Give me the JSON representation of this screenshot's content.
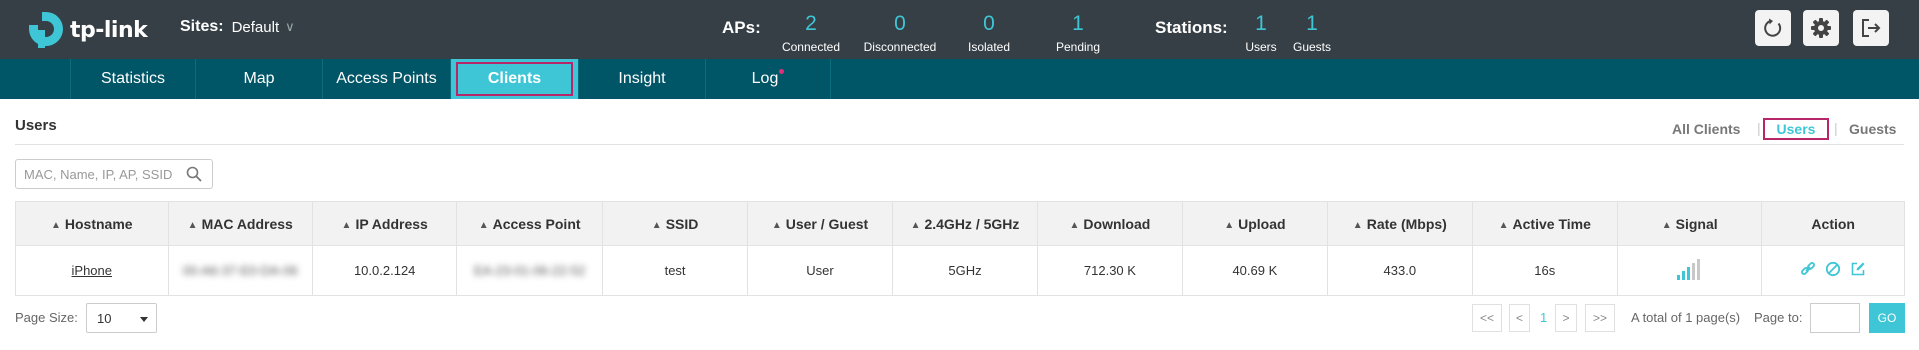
{
  "brand": {
    "name": "tp-link"
  },
  "header": {
    "sites_label": "Sites:",
    "site_value": "Default",
    "aps_label": "APs:",
    "aps": [
      {
        "value": "2",
        "caption": "Connected"
      },
      {
        "value": "0",
        "caption": "Disconnected"
      },
      {
        "value": "0",
        "caption": "Isolated"
      },
      {
        "value": "1",
        "caption": "Pending"
      }
    ],
    "stations_label": "Stations:",
    "stations": [
      {
        "value": "1",
        "caption": "Users"
      },
      {
        "value": "1",
        "caption": "Guests"
      }
    ],
    "icons": [
      "refresh-icon",
      "gear-icon",
      "logout-icon"
    ]
  },
  "nav": {
    "items": [
      "Statistics",
      "Map",
      "Access Points",
      "Clients",
      "Insight",
      "Log"
    ],
    "active": "Clients"
  },
  "page": {
    "title": "Users",
    "filters": {
      "all": "All Clients",
      "users": "Users",
      "guests": "Guests",
      "active": "Users"
    }
  },
  "search": {
    "placeholder": "MAC, Name, IP, AP, SSID"
  },
  "table": {
    "columns": [
      "Hostname",
      "MAC Address",
      "IP Address",
      "Access Point",
      "SSID",
      "User / Guest",
      "2.4GHz / 5GHz",
      "Download",
      "Upload",
      "Rate (Mbps)",
      "Active Time",
      "Signal",
      "Action"
    ],
    "rows": [
      {
        "hostname": "iPhone",
        "mac": "00-A6-37-E0-DA-06",
        "ip": "10.0.2.124",
        "ap": "EA-23-01-06-22-52",
        "ssid": "test",
        "user_guest": "User",
        "band": "5GHz",
        "download": "712.30 K",
        "upload": "40.69 K",
        "rate": "433.0",
        "active_time": "16s",
        "signal_bars": 3,
        "signal_max": 5
      }
    ]
  },
  "footer": {
    "page_size_label": "Page Size:",
    "page_size": "10",
    "first": "<<",
    "prev": "<",
    "current_page": "1",
    "next": ">",
    "last": ">>",
    "total": "A total of 1 page(s)",
    "page_to_label": "Page to:",
    "go": "GO"
  },
  "colors": {
    "header_bg": "#353f45",
    "nav_bg": "#005566",
    "accent": "#3fc6d6",
    "highlight": "#b8266a"
  }
}
